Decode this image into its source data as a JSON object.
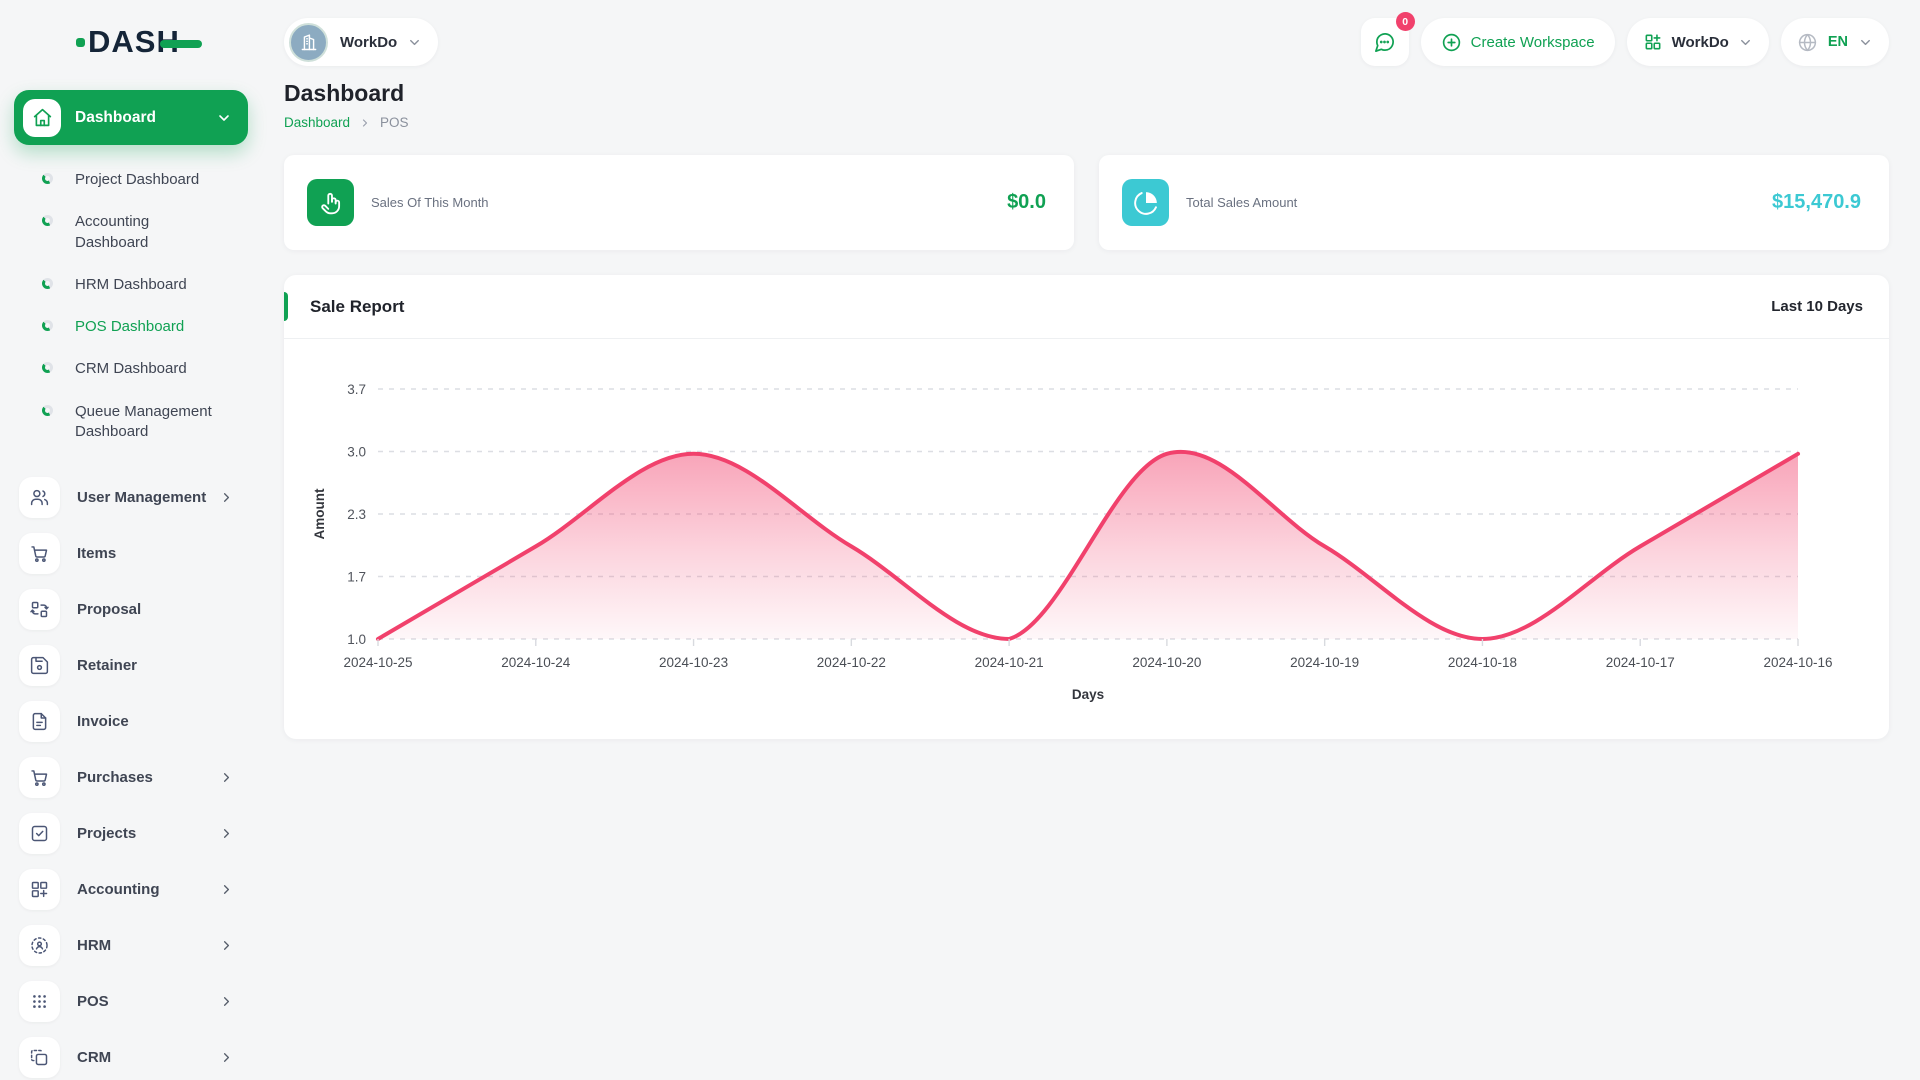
{
  "brand": {
    "logo": "DASH"
  },
  "topbar": {
    "workspace": {
      "name": "WorkDo",
      "avatar_icon": "building-icon"
    },
    "messages": {
      "icon": "chat-icon",
      "badge": "0"
    },
    "create_workspace_label": "Create Workspace",
    "app_menu": {
      "label": "WorkDo",
      "icon": "grid-plus-icon"
    },
    "language": {
      "code": "EN",
      "icon": "globe-icon"
    }
  },
  "sidebar": {
    "group": {
      "label": "Dashboard",
      "icon": "home-icon"
    },
    "children": [
      {
        "label": "Project Dashboard",
        "active": false
      },
      {
        "label": "Accounting Dashboard",
        "active": false
      },
      {
        "label": "HRM Dashboard",
        "active": false
      },
      {
        "label": "POS Dashboard",
        "active": true
      },
      {
        "label": "CRM Dashboard",
        "active": false
      },
      {
        "label": "Queue Management Dashboard",
        "active": false
      }
    ],
    "items": [
      {
        "label": "User Management",
        "icon": "users-icon",
        "expandable": true
      },
      {
        "label": "Items",
        "icon": "cart-icon",
        "expandable": false
      },
      {
        "label": "Proposal",
        "icon": "proposal-icon",
        "expandable": false
      },
      {
        "label": "Retainer",
        "icon": "retainer-icon",
        "expandable": false
      },
      {
        "label": "Invoice",
        "icon": "invoice-icon",
        "expandable": false
      },
      {
        "label": "Purchases",
        "icon": "cart-icon",
        "expandable": true
      },
      {
        "label": "Projects",
        "icon": "projects-icon",
        "expandable": true
      },
      {
        "label": "Accounting",
        "icon": "accounting-icon",
        "expandable": true
      },
      {
        "label": "HRM",
        "icon": "hrm-icon",
        "expandable": true
      },
      {
        "label": "POS",
        "icon": "pos-icon",
        "expandable": true
      },
      {
        "label": "CRM",
        "icon": "crm-icon",
        "expandable": true
      }
    ]
  },
  "page": {
    "title": "Dashboard",
    "breadcrumb": [
      {
        "label": "Dashboard",
        "link": true
      },
      {
        "label": "POS",
        "link": false
      }
    ]
  },
  "stats": [
    {
      "label": "Sales Of This Month",
      "value": "$0.0",
      "icon": "tap-icon",
      "accent": "#10a153"
    },
    {
      "label": "Total Sales Amount",
      "value": "$15,470.9",
      "icon": "pie-chart-icon",
      "accent": "#3cc9d3"
    }
  ],
  "sale_report": {
    "title": "Sale Report",
    "range": "Last 10 Days"
  },
  "chart_data": {
    "type": "area",
    "title": "Sale Report",
    "x": [
      "2024-10-25",
      "2024-10-24",
      "2024-10-23",
      "2024-10-22",
      "2024-10-21",
      "2024-10-20",
      "2024-10-19",
      "2024-10-18",
      "2024-10-17",
      "2024-10-16"
    ],
    "values": [
      1,
      2,
      3,
      2,
      1,
      3,
      2,
      1,
      2,
      3
    ],
    "xlabel": "Days",
    "ylabel": "Amount",
    "yticks": [
      "1.0",
      "1.7",
      "2.3",
      "3.0",
      "3.7"
    ],
    "ylim": [
      1.0,
      3.7
    ],
    "line_color": "#f1416c",
    "fill": "pink gradient to white",
    "grid": "dashed horizontal",
    "legend": "none"
  }
}
